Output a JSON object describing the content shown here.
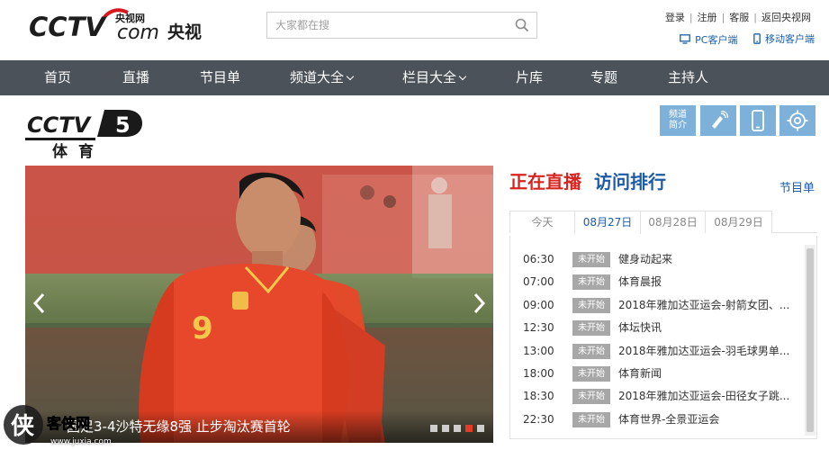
{
  "header": {
    "logo_mark": "CCTV",
    "logo_small": "央视网",
    "logo_com": "com",
    "logo_cn": "央视",
    "search_placeholder": "大家都在搜",
    "toplinks": [
      "登录",
      "注册",
      "客服",
      "返回央视网"
    ],
    "clients": [
      "PC客户端",
      "移动客户端"
    ]
  },
  "nav": {
    "items": [
      "首页",
      "直播",
      "节目单",
      "频道大全",
      "栏目大全",
      "片库",
      "专题",
      "主持人"
    ]
  },
  "channel": {
    "logo_text": "CCTV",
    "number": "5",
    "name": "体育",
    "intro_label": "频道\n简介",
    "buttons": [
      "channel-intro",
      "remote-icon",
      "phone-icon",
      "target-icon"
    ],
    "button_color": "#7eb1d9"
  },
  "hero": {
    "caption": "国足3-4沙特无缘8强 止步淘汰赛首轮",
    "dots": 5,
    "active_dot": 3,
    "jersey_number": "9"
  },
  "panel": {
    "tab_live": "正在直播",
    "tab_rank": "访问排行",
    "program_link": "节目单",
    "days": [
      "今天",
      "08月27日",
      "08月28日",
      "08月29日"
    ],
    "active_day": 1,
    "schedule": [
      {
        "time": "06:30",
        "status": "未开始",
        "title": "健身动起来"
      },
      {
        "time": "07:00",
        "status": "未开始",
        "title": "体育晨报"
      },
      {
        "time": "09:00",
        "status": "未开始",
        "title": "2018年雅加达亚运会-射箭女团、..."
      },
      {
        "time": "12:30",
        "status": "未开始",
        "title": "体坛快讯"
      },
      {
        "time": "13:00",
        "status": "未开始",
        "title": "2018年雅加达亚运会-羽毛球男单..."
      },
      {
        "time": "18:00",
        "status": "未开始",
        "title": "体育新闻"
      },
      {
        "time": "18:30",
        "status": "未开始",
        "title": "2018年雅加达亚运会-田径女子跳..."
      },
      {
        "time": "22:30",
        "status": "未开始",
        "title": "体育世界-全景亚运会"
      }
    ]
  },
  "watermark": {
    "text": "侠客侠网",
    "url": "www.juxia.com"
  },
  "colors": {
    "nav_bg": "#4b5259",
    "live_red": "#d8241f",
    "rank_blue": "#1d5ba5",
    "badge_gray": "#a7a7a7"
  }
}
